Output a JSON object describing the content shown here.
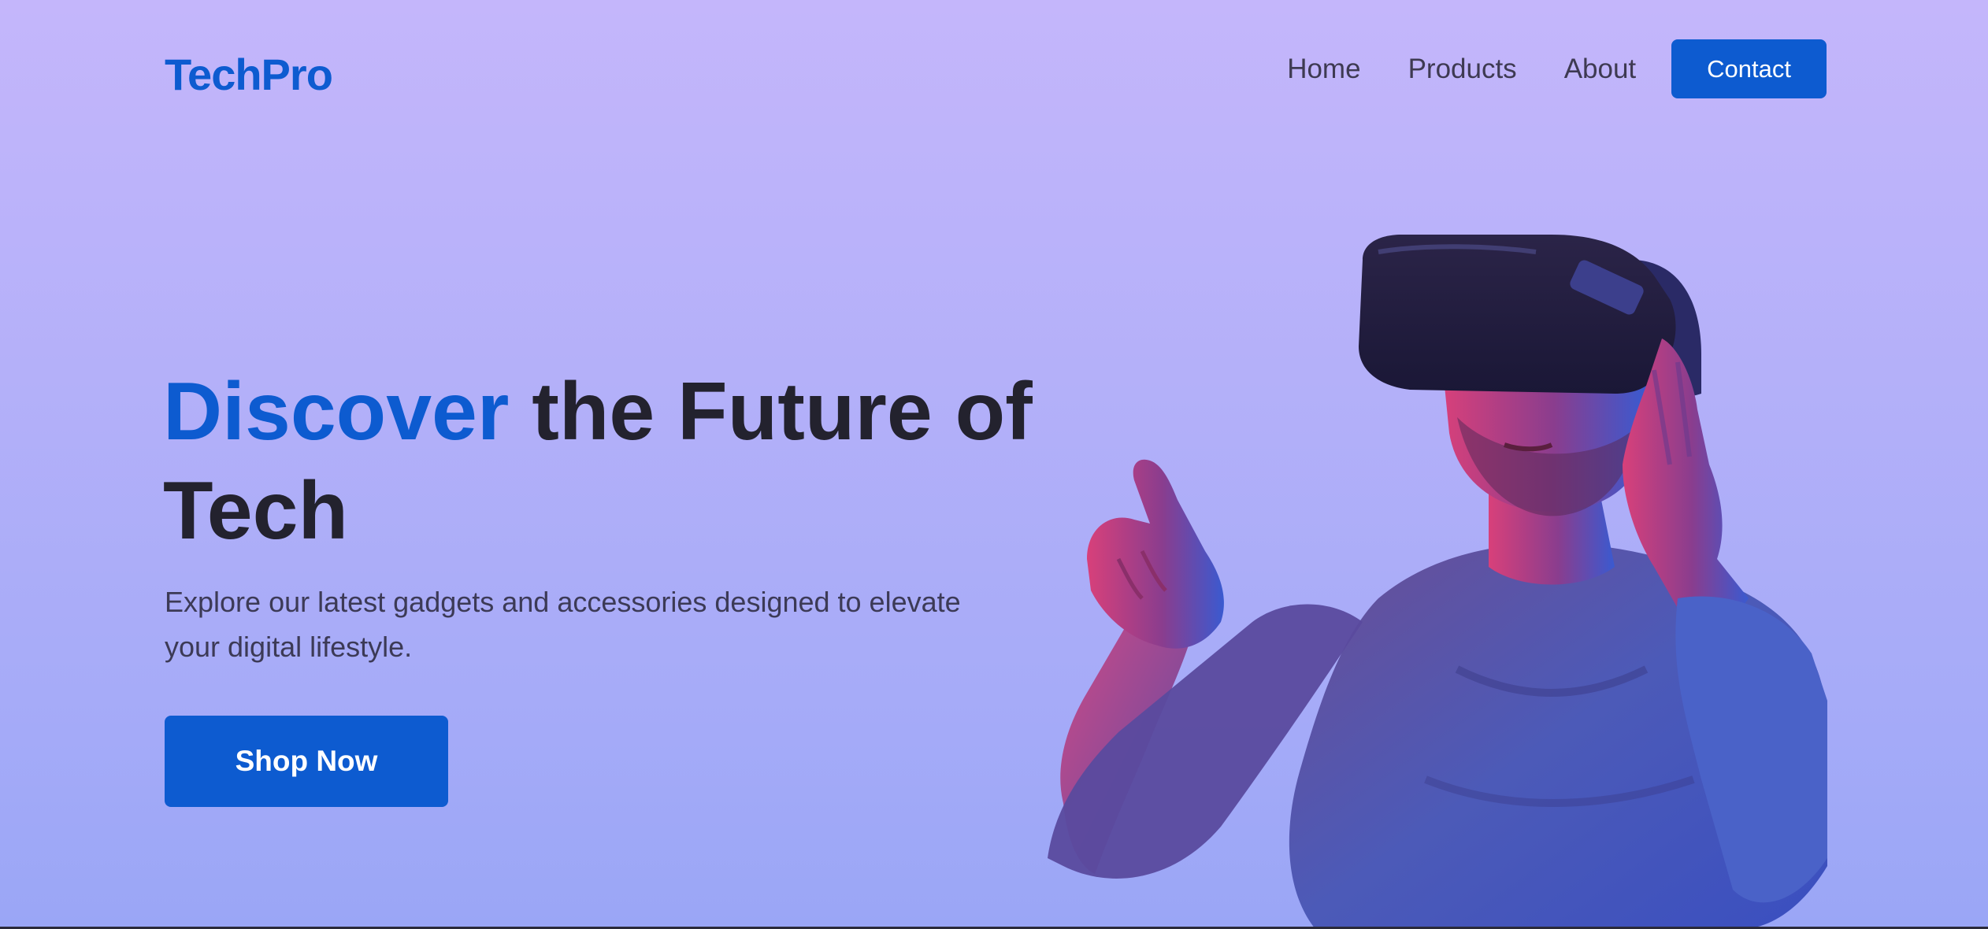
{
  "brand": {
    "name": "TechPro"
  },
  "nav": {
    "items": [
      {
        "label": "Home"
      },
      {
        "label": "Products"
      },
      {
        "label": "About"
      }
    ],
    "contact_label": "Contact"
  },
  "hero": {
    "title_accent": "Discover",
    "title_rest": "the Future of Tech",
    "subtitle": "Explore our latest gadgets and accessories designed to elevate your digital lifestyle.",
    "cta_label": "Shop Now",
    "image_alt": "Man wearing a VR headset pointing forward"
  },
  "colors": {
    "accent": "#0d5bd0",
    "heading": "#23222e",
    "background_top": "#c4b6fb",
    "background_bottom": "#9aa6f6"
  }
}
